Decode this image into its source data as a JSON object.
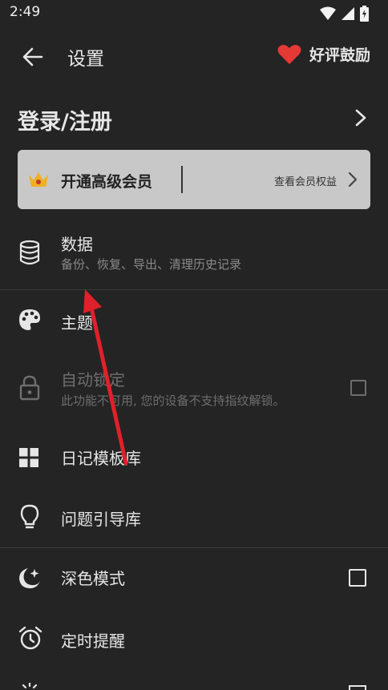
{
  "status_bar": {
    "time": "2:49"
  },
  "toolbar": {
    "title": "设置",
    "rate_label": "好评鼓励"
  },
  "login": {
    "label": "登录/注册"
  },
  "vip": {
    "title": "开通高级会员",
    "link": "查看会员权益"
  },
  "settings": {
    "data": {
      "title": "数据",
      "subtitle": "备份、恢复、导出、清理历史记录"
    },
    "theme": {
      "title": "主题"
    },
    "autolock": {
      "title": "自动锁定",
      "subtitle": "此功能不可用, 您的设备不支持指纹解锁。",
      "checked": false,
      "enabled": false
    },
    "templates": {
      "title": "日记模板库"
    },
    "prompts": {
      "title": "问题引导库"
    },
    "dark_mode": {
      "title": "深色模式",
      "checked": false
    },
    "reminder": {
      "title": "定时提醒"
    }
  },
  "colors": {
    "background": "#242424",
    "accent_heart": "#e53935",
    "annotation_arrow": "#e0202a"
  }
}
